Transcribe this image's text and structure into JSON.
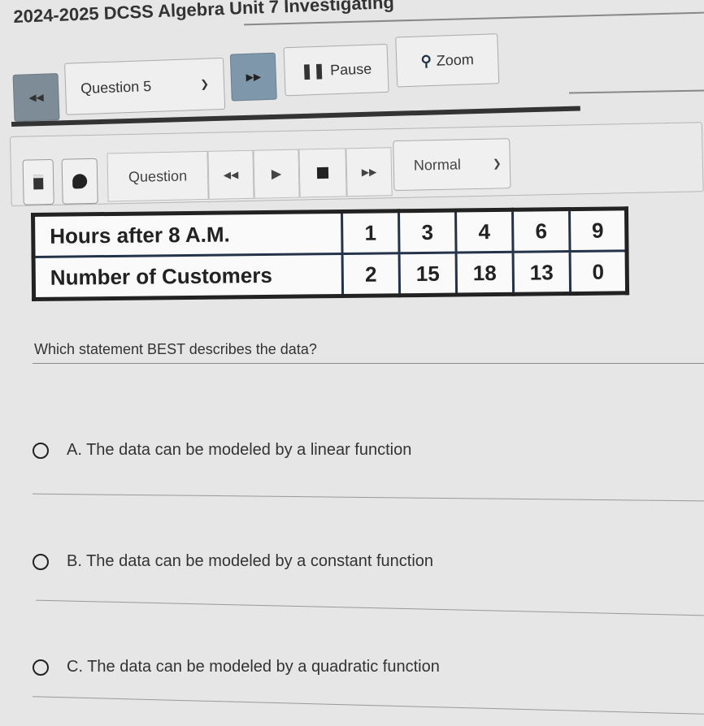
{
  "window": {
    "title": "2024-2025 DCSS Algebra Unit 7 Investigating"
  },
  "toolbar": {
    "prev_icon": "rewind-icon",
    "question_select": {
      "selected": "Question 5"
    },
    "next_icon": "fast-forward-icon",
    "pause_label": "Pause",
    "zoom_label": "Zoom"
  },
  "tts_toolbar": {
    "question_label": "Question",
    "speed_select": {
      "selected": "Normal"
    },
    "icons": [
      "notepad-icon",
      "highlighter-icon",
      "rewind-icon",
      "play-icon",
      "stop-icon",
      "fast-forward-icon"
    ]
  },
  "table": {
    "rows": [
      {
        "header": "Hours after 8 A.M.",
        "values": [
          "1",
          "3",
          "4",
          "6",
          "9"
        ]
      },
      {
        "header": "Number of Customers",
        "values": [
          "2",
          "15",
          "18",
          "13",
          "0"
        ]
      }
    ]
  },
  "question": {
    "prompt": "Which statement BEST describes the data?",
    "choices": [
      {
        "label": "A. The data can be modeled by a linear function"
      },
      {
        "label": "B. The data can be modeled by a constant function"
      },
      {
        "label": "C. The data can be modeled by a quadratic function"
      }
    ]
  }
}
